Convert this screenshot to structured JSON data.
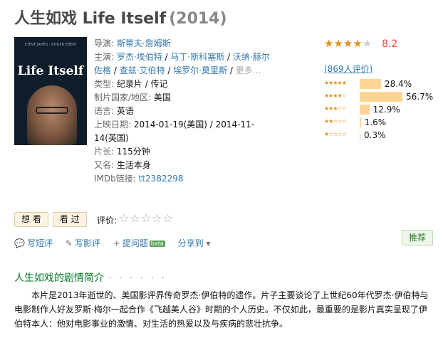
{
  "title": {
    "name": "人生如戏 Life Itself",
    "year": "(2014)"
  },
  "poster": {
    "title_text": "Life Itself",
    "tagline": "STEVE JAMES · ROGER EBERT"
  },
  "info": {
    "director_label": "导演:",
    "director": "斯蒂夫·詹姆斯",
    "cast_label": "主演:",
    "cast": [
      "罗杰·埃伯特",
      "马丁·斯科塞斯",
      "沃纳·赫尔佐格",
      "查兹·艾伯特",
      "埃罗尔·莫里斯"
    ],
    "cast_more": "更多...",
    "genre_label": "类型:",
    "genre": "纪录片 / 传记",
    "country_label": "制片国家/地区:",
    "country": "美国",
    "language_label": "语言:",
    "language": "英语",
    "release_label": "上映日期:",
    "release_1": "2014-01-19(美国)",
    "release_sep": " / ",
    "release_2": "2014-11-14(英国)",
    "runtime_label": "片长:",
    "runtime": "115分钟",
    "aka_label": "又名:",
    "aka": "生活本身",
    "imdb_label": "IMDb链接:",
    "imdb": "tt2382298"
  },
  "rating": {
    "score": "8.2",
    "stars_value": 4.5,
    "votes": "(869人评价)",
    "breakdown": [
      {
        "stars": 5,
        "pct": "28.4%",
        "value": 28.4
      },
      {
        "stars": 4,
        "pct": "56.7%",
        "value": 56.7
      },
      {
        "stars": 3,
        "pct": "12.9%",
        "value": 12.9
      },
      {
        "stars": 2,
        "pct": "1.6%",
        "value": 1.6
      },
      {
        "stars": 1,
        "pct": "0.3%",
        "value": 0.3
      }
    ]
  },
  "buttons": {
    "want": "想 看",
    "seen": "看 过"
  },
  "rate_label": "评价:",
  "actions": {
    "short_review": "写短评",
    "review": "写影评",
    "question": "提问题",
    "beta": "beta",
    "share": "分享到"
  },
  "recommend": "推荐",
  "section_title": "人生如戏的剧情简介",
  "section_dots": "· · · · · ·",
  "summary": "本片是2013年逝世的、美国影评界传奇罗杰·伊伯特的遗作。片子主要谈论了上世纪60年代罗杰·伊伯特与电影制作人好友罗斯·梅尔一起合作《飞越美人谷》时期的个人历史。不仅如此，最重要的是影片真实呈现了伊伯特本人：他对电影事业的激情、对生活的热爱以及与疾病的悲壮抗争。",
  "colors": {
    "accent_green": "#007722",
    "link": "#3377aa",
    "star": "#e09015",
    "score_red": "#e3463e",
    "bar": "#ffd596"
  }
}
